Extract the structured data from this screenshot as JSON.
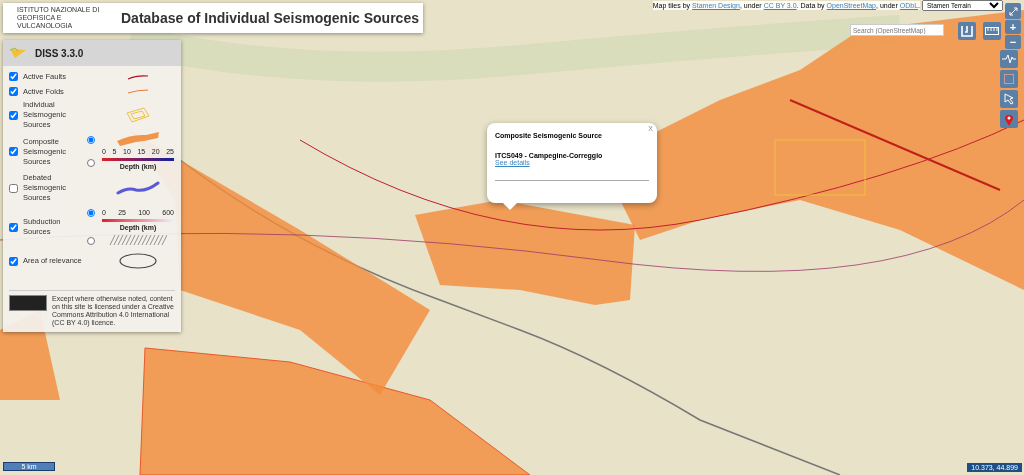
{
  "header": {
    "org": "ISTITUTO NAZIONALE DI GEOFISICA E VULCANOLOGIA",
    "title": "Database of Individual Seismogenic Sources"
  },
  "attribution": [
    {
      "kind": "text",
      "text": "Map tiles by "
    },
    {
      "kind": "link",
      "text": "Stamen Design"
    },
    {
      "kind": "text",
      "text": ", under "
    },
    {
      "kind": "link",
      "text": "CC BY 3.0"
    },
    {
      "kind": "text",
      "text": ". Data by "
    },
    {
      "kind": "link",
      "text": "OpenStreetMap"
    },
    {
      "kind": "text",
      "text": ", under "
    },
    {
      "kind": "link",
      "text": "ODbL"
    },
    {
      "kind": "text",
      "text": "."
    }
  ],
  "basemap_select": {
    "value": "Stamen Terrain"
  },
  "search": {
    "placeholder": "Search (OpenStreetMap)"
  },
  "zoom_buttons": [
    "+",
    "−"
  ],
  "legend": {
    "title": "DISS 3.3.0",
    "layers": [
      {
        "kind": "fault",
        "label": "Active Faults",
        "checked": true
      },
      {
        "kind": "fold",
        "label": "Active Folds",
        "checked": true
      },
      {
        "kind": "individual",
        "label": "Individual Seismogenic Sources",
        "checked": true
      },
      {
        "kind": "composite",
        "label": "Composite Seismogenic Sources",
        "checked": true,
        "options": [
          {
            "selected": true
          },
          {
            "selected": false
          }
        ],
        "scale": {
          "ticks": [
            "0",
            "5",
            "10",
            "15",
            "20",
            "25"
          ],
          "label": "Depth (km)"
        }
      },
      {
        "kind": "debated",
        "label": "Debated Seismogenic Sources",
        "checked": false
      },
      {
        "kind": "subduction",
        "label": "Subduction Sources",
        "checked": true,
        "options": [
          {
            "selected": true
          },
          {
            "selected": false
          }
        ],
        "scale": {
          "ticks": [
            "0",
            "25",
            "100",
            "600"
          ],
          "label": "Depth (km)"
        }
      },
      {
        "kind": "area",
        "label": "Area of relevance",
        "checked": true
      }
    ],
    "licence": "Except where otherwise noted, content on this site is licensed under a Creative Commons Attribution 4.0 International (CC BY 4.0) licence."
  },
  "popup": {
    "close": "X",
    "heading": "Composite Seismogenic Source",
    "source": "ITCS049 - Campegine-Correggio",
    "link": "See details"
  },
  "scale_bar": "5 km",
  "coordinates": "10.373, 44.899"
}
